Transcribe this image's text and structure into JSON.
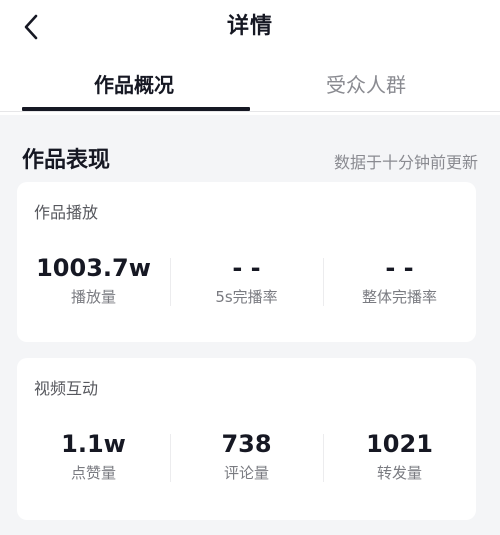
{
  "nav": {
    "title": "详情"
  },
  "tabs": [
    {
      "label": "作品概况",
      "active": true
    },
    {
      "label": "受众人群",
      "active": false
    }
  ],
  "section": {
    "title": "作品表现",
    "note": "数据于十分钟前更新"
  },
  "cards": [
    {
      "title": "作品播放",
      "metrics": [
        {
          "value": "1003.7w",
          "label": "播放量"
        },
        {
          "value": "- -",
          "label": "5s完播率"
        },
        {
          "value": "- -",
          "label": "整体完播率"
        }
      ]
    },
    {
      "title": "视频互动",
      "metrics": [
        {
          "value": "1.1w",
          "label": "点赞量"
        },
        {
          "value": "738",
          "label": "评论量"
        },
        {
          "value": "1021",
          "label": "转发量"
        }
      ]
    }
  ],
  "icons": {
    "back": "chevron-left-icon"
  },
  "colors": {
    "page_background": "#f4f5f7",
    "card_background": "#ffffff",
    "primary_text": "#161823",
    "secondary_text": "#8a8b91"
  }
}
